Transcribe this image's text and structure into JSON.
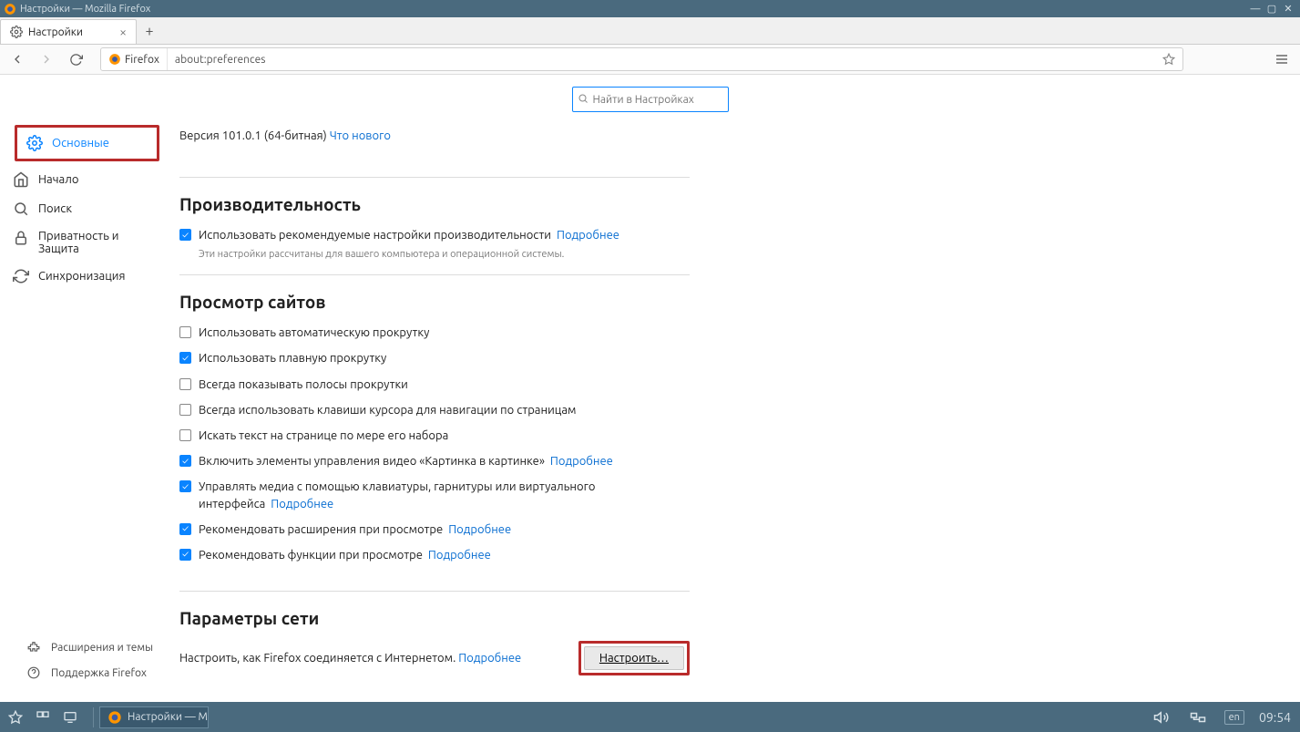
{
  "window": {
    "title": "Настройки — Mozilla Firefox"
  },
  "tab": {
    "title": "Настройки"
  },
  "url": {
    "identity": "Firefox",
    "value": "about:preferences"
  },
  "search": {
    "placeholder": "Найти в Настройках"
  },
  "sidebar": {
    "general": "Основные",
    "home": "Начало",
    "search": "Поиск",
    "privacy": "Приватность и Защита",
    "sync": "Синхронизация",
    "ext": "Расширения и темы",
    "support": "Поддержка Firefox"
  },
  "main": {
    "version_prefix": "Версия 101.0.1 (64-битная) ",
    "whatsnew": "Что нового",
    "perf_title": "Производительность",
    "perf_chk": "Использовать рекомендуемые настройки производительности",
    "perf_more": "Подробнее",
    "perf_note": "Эти настройки рассчитаны для вашего компьютера и операционной системы.",
    "browse_title": "Просмотр сайтов",
    "b1": "Использовать автоматическую прокрутку",
    "b2": "Использовать плавную прокрутку",
    "b3": "Всегда показывать полосы прокрутки",
    "b4": "Всегда использовать клавиши курсора для навигации по страницам",
    "b5": "Искать текст на странице по мере его набора",
    "b6": "Включить элементы управления видео «Картинка в картинке»",
    "b6_more": "Подробнее",
    "b7": "Управлять медиа с помощью клавиатуры, гарнитуры или виртуального интерфейса",
    "b7_more": "Подробнее",
    "b8": "Рекомендовать расширения при просмотре",
    "b8_more": "Подробнее",
    "b9": "Рекомендовать функции при просмотре",
    "b9_more": "Подробнее",
    "net_title": "Параметры сети",
    "net_desc": "Настроить, как Firefox соединяется с Интернетом. ",
    "net_more": "Подробнее",
    "net_btn": "Настроить…"
  },
  "taskbar": {
    "task": "Настройки — Mozi…",
    "lang": "en",
    "clock": "09:54"
  }
}
